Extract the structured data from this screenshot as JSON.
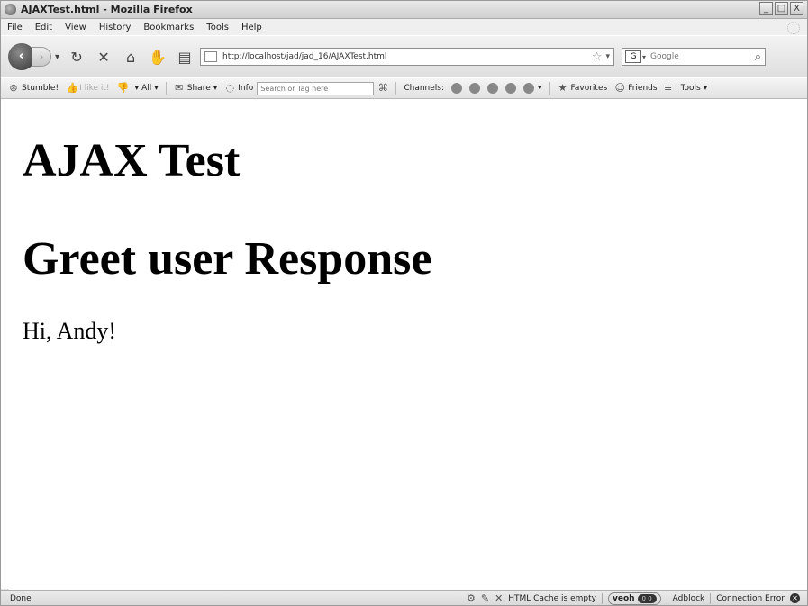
{
  "window": {
    "title": "AJAXTest.html - Mozilla Firefox",
    "controls": {
      "minimize": "_",
      "maximize": "□",
      "close": "X"
    }
  },
  "menu": [
    "File",
    "Edit",
    "View",
    "History",
    "Bookmarks",
    "Tools",
    "Help"
  ],
  "nav": {
    "back_icon": "back-arrow-icon",
    "forward_icon": "forward-arrow-icon",
    "url": "http://localhost/jad/jad_16/AJAXTest.html",
    "search_engine": "G",
    "search_placeholder": "Google"
  },
  "stumble": {
    "stumble_label": "Stumble!",
    "ilike_label": "I like it!",
    "all_label": "All",
    "share_label": "Share",
    "info_label": "Info",
    "search_placeholder": "Search or Tag here",
    "channels_label": "Channels:",
    "favorites_label": "Favorites",
    "friends_label": "Friends",
    "tools_label": "Tools"
  },
  "page": {
    "heading1": "AJAX Test",
    "heading2": "Greet user Response",
    "message": "Hi, Andy!"
  },
  "status": {
    "left": "Done",
    "cache": "HTML Cache is empty",
    "veoh": "veoh",
    "veoh_counts": "0  0",
    "adblock": "Adblock",
    "connection": "Connection Error"
  }
}
